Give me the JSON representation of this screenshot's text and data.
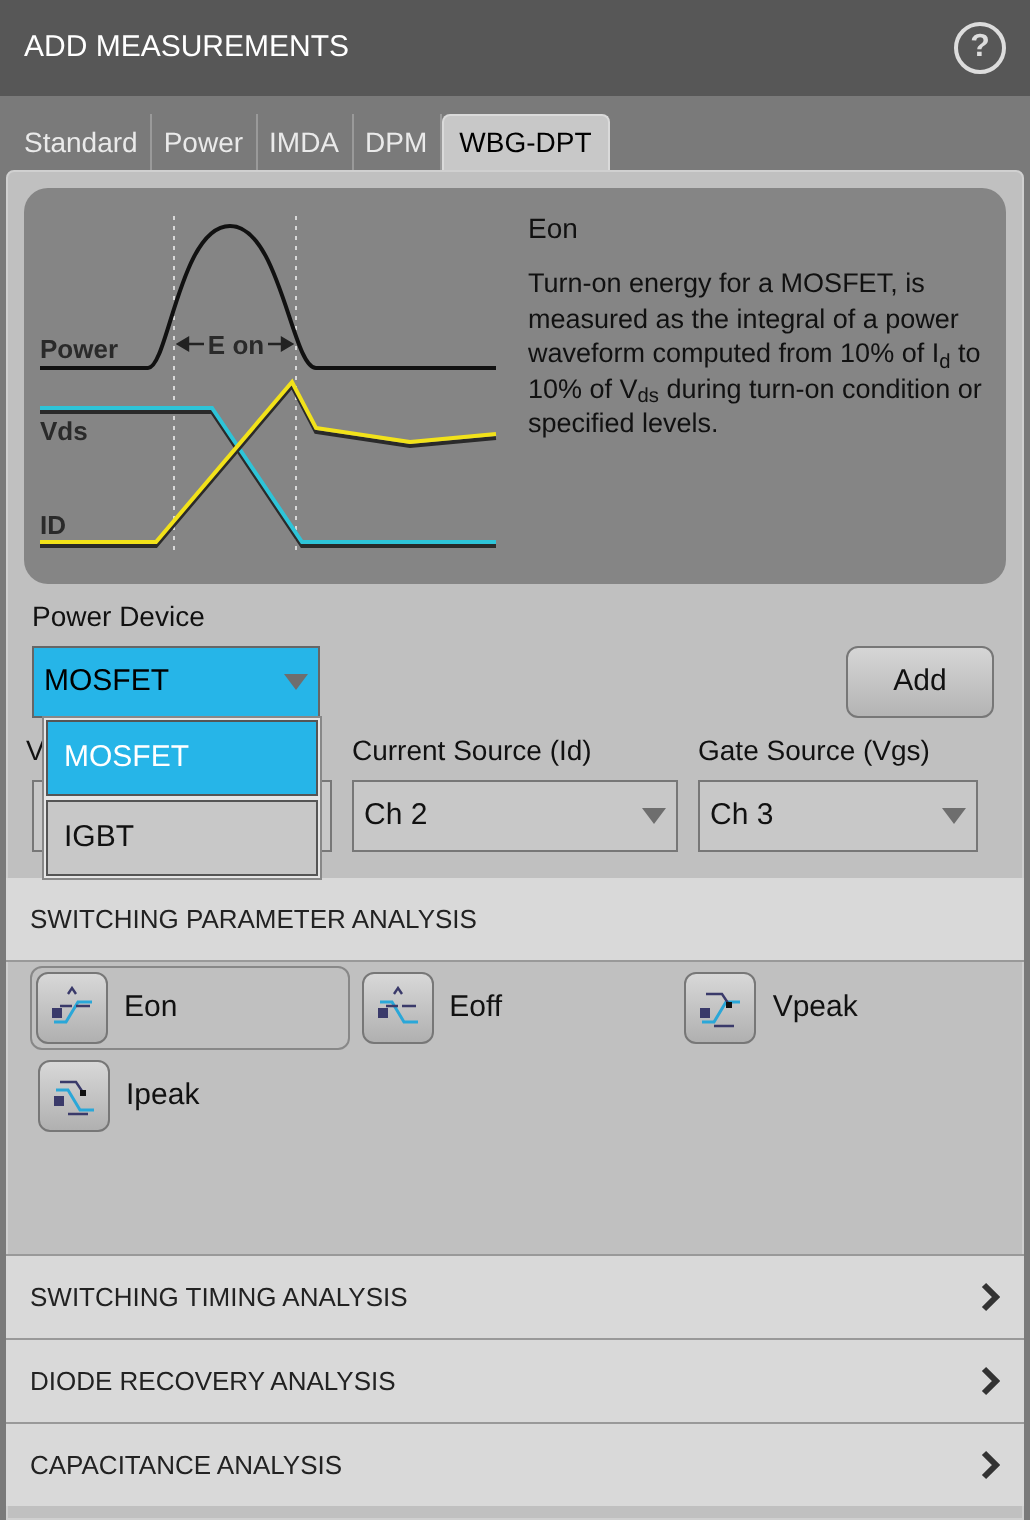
{
  "window": {
    "title": "ADD MEASUREMENTS",
    "help": "?"
  },
  "tabs": [
    {
      "label": "Standard",
      "selected": false
    },
    {
      "label": "Power",
      "selected": false
    },
    {
      "label": "IMDA",
      "selected": false
    },
    {
      "label": "DPM",
      "selected": false
    },
    {
      "label": "WBG-DPT",
      "selected": true
    }
  ],
  "diagram": {
    "labels": [
      "Power",
      "Vds",
      "ID"
    ],
    "span_label": "E on"
  },
  "description": {
    "title": "Eon",
    "text": "Turn-on energy for a MOSFET, is measured as the integral of a power waveform computed from 10% of I$_{d}$ to 10% of V$_{ds}$ during turn-on condition or specified levels."
  },
  "power_device": {
    "label": "Power Device",
    "value": "MOSFET",
    "expanded": true,
    "options": [
      {
        "label": "MOSFET",
        "selected": true
      },
      {
        "label": "IGBT",
        "selected": false
      }
    ]
  },
  "add_button": "Add",
  "sources": [
    {
      "label": "V"
    },
    {
      "label": "Current Source (Id)",
      "value": "Ch 2"
    },
    {
      "label": "Gate Source (Vgs)",
      "value": "Ch 3"
    }
  ],
  "sections": [
    {
      "title": "SWITCHING PARAMETER ANALYSIS",
      "expanded": true,
      "items": [
        {
          "label": "Eon",
          "selected": true
        },
        {
          "label": "Eoff",
          "selected": false
        },
        {
          "label": "Vpeak",
          "selected": false
        },
        {
          "label": "Ipeak",
          "selected": false
        }
      ]
    },
    {
      "title": "SWITCHING TIMING ANALYSIS",
      "expanded": false
    },
    {
      "title": "DIODE RECOVERY ANALYSIS",
      "expanded": false
    },
    {
      "title": "CAPACITANCE ANALYSIS",
      "expanded": false
    }
  ]
}
